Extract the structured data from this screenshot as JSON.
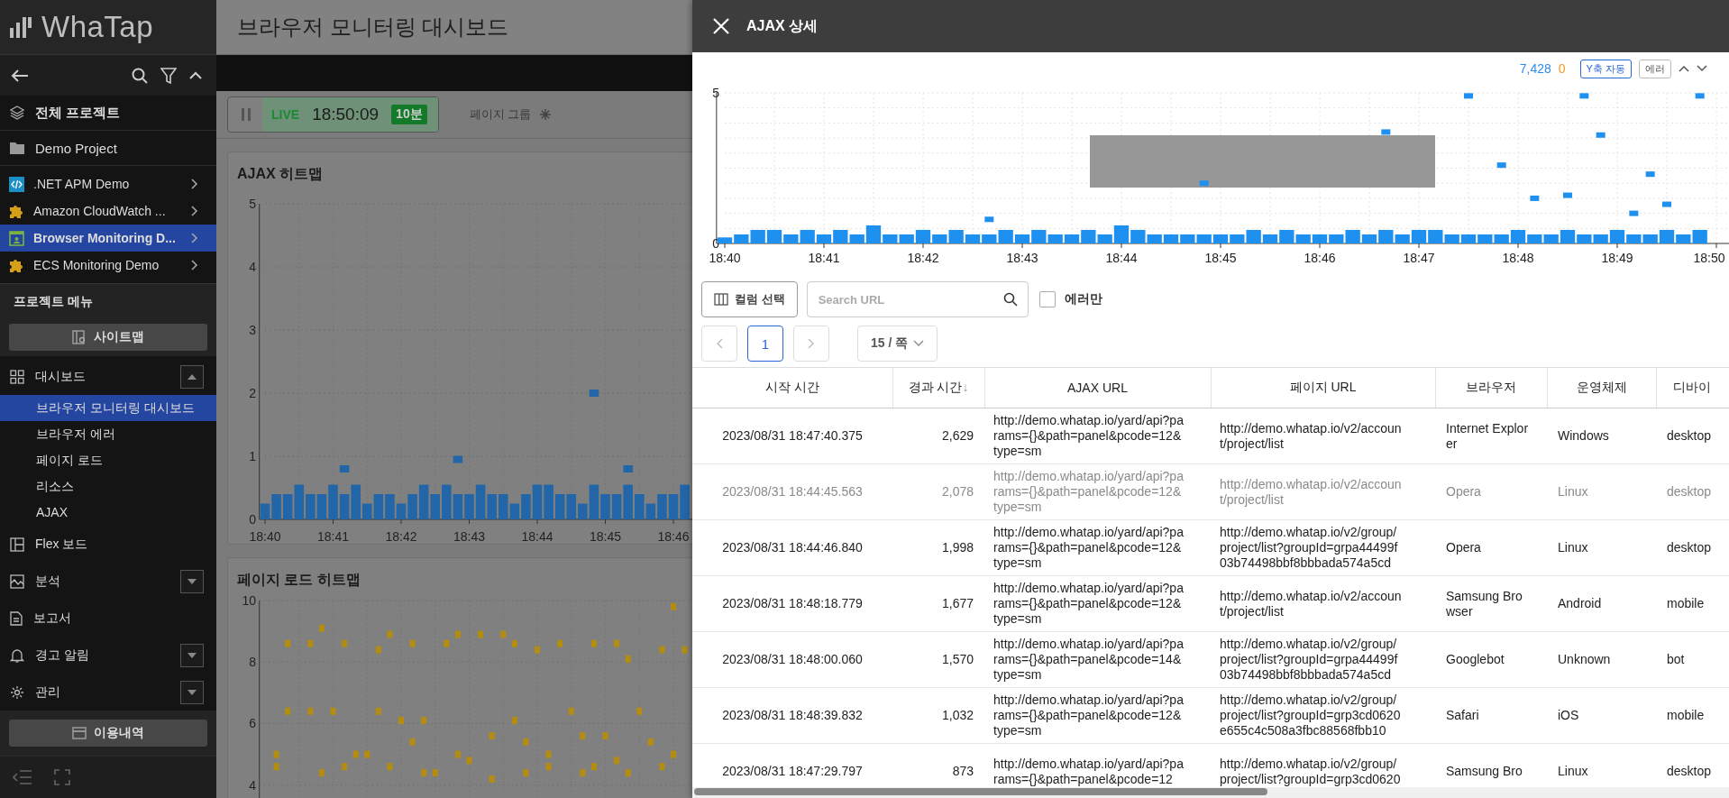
{
  "sidebar": {
    "logo": "WhaTap",
    "all_projects": "전체 프로젝트",
    "group": "Demo Project",
    "projects": [
      {
        "label": ".NET APM Demo",
        "selected": false
      },
      {
        "label": "Amazon CloudWatch ...",
        "selected": false
      },
      {
        "label": "Browser Monitoring D...",
        "selected": true
      },
      {
        "label": "ECS Monitoring Demo",
        "selected": false
      }
    ],
    "menu_title": "프로젝트 메뉴",
    "sitemap_button": "사이트맵",
    "menu": [
      {
        "kind": "group",
        "label": "대시보드",
        "expanded": true,
        "children": [
          {
            "label": "브라우저 모니터링 대시보드",
            "selected": true
          },
          {
            "label": "브라우저 에러",
            "selected": false
          },
          {
            "label": "페이지 로드",
            "selected": false
          },
          {
            "label": "리소스",
            "selected": false
          },
          {
            "label": "AJAX",
            "selected": false
          }
        ]
      },
      {
        "kind": "link",
        "label": "Flex 보드"
      },
      {
        "kind": "group",
        "label": "분석",
        "expanded": false
      },
      {
        "kind": "link",
        "label": "보고서"
      },
      {
        "kind": "group",
        "label": "경고 알림",
        "expanded": false
      },
      {
        "kind": "group",
        "label": "관리",
        "expanded": false
      }
    ],
    "usage_button": "이용내역"
  },
  "dashboard": {
    "title": "브라우저 모니터링 대시보드",
    "live": {
      "label": "LIVE",
      "time": "18:50:09",
      "range": "10분"
    },
    "page_group": "페이지 그룹",
    "ajax_heatmap": {
      "title": "AJAX 히트맵",
      "chart_data": {
        "type": "bar",
        "grid": true,
        "categories": [
          "18:40",
          null,
          null,
          null,
          null,
          null,
          "18:41",
          null,
          null,
          null,
          null,
          null,
          "18:42",
          null,
          null,
          null,
          null,
          null,
          "18:43",
          null,
          null,
          null,
          null,
          null,
          "18:44",
          null,
          null,
          null,
          null,
          null,
          "18:45",
          null,
          null,
          null,
          null,
          null,
          "18:46",
          null
        ],
        "series": [
          {
            "color": "#2266a8",
            "values": [
              0.25,
              0.4,
              0.4,
              0.55,
              0.4,
              0.4,
              0.55,
              0.4,
              0.55,
              0.25,
              0.4,
              0.4,
              0.25,
              0.4,
              0.55,
              0.4,
              0.55,
              0.4,
              0.4,
              0.55,
              0.4,
              0.4,
              0.25,
              0.4,
              0.55,
              0.55,
              0.4,
              0.4,
              0.25,
              0.55,
              0.4,
              0.4,
              0.55,
              0.4,
              0.25,
              0.4,
              0.4,
              0.55
            ]
          },
          {
            "type": "scatter",
            "color": "#2266a8",
            "values": [
              null,
              null,
              null,
              null,
              null,
              null,
              null,
              0.8,
              null,
              null,
              null,
              null,
              null,
              null,
              null,
              null,
              null,
              0.95,
              null,
              null,
              null,
              null,
              null,
              null,
              null,
              null,
              null,
              null,
              null,
              2.0,
              null,
              null,
              0.8,
              null,
              null,
              null,
              null,
              null
            ]
          }
        ],
        "ylim": [
          0,
          5
        ],
        "yticks": [
          0,
          1,
          2,
          3,
          4,
          5
        ]
      }
    },
    "pageload_heatmap": {
      "title": "페이지 로드 히트맵",
      "chart_data": {
        "type": "scatter",
        "grid": true,
        "categories": [
          null,
          null,
          null,
          null,
          null,
          null,
          null,
          null,
          null,
          null,
          null,
          null,
          null,
          null,
          null,
          null,
          null,
          null,
          null,
          null,
          null,
          null,
          null,
          null,
          null,
          null,
          null,
          null,
          null,
          null,
          null,
          null,
          null,
          null,
          null,
          null,
          null,
          null
        ],
        "series": [
          {
            "color": "#b38c10",
            "values": [
              null,
              null,
              8.6,
              null,
              8.6,
              9.1,
              null,
              8.6,
              null,
              null,
              8.4,
              8.9,
              null,
              8.6,
              null,
              null,
              8.6,
              8.9,
              null,
              8.9,
              null,
              8.9,
              8.6,
              null,
              8.4,
              null,
              8.6,
              null,
              null,
              8.6,
              null,
              8.6,
              8.1,
              null,
              null,
              8.4,
              9.8,
              8.4
            ]
          },
          {
            "color": "#b38c10",
            "values": [
              null,
              5.0,
              6.4,
              null,
              6.4,
              null,
              6.4,
              null,
              null,
              null,
              6.4,
              null,
              6.1,
              5.4,
              6.1,
              null,
              null,
              null,
              null,
              null,
              5.6,
              null,
              6.1,
              5.4,
              null,
              5.0,
              null,
              6.4,
              5.6,
              null,
              5.6,
              null,
              null,
              6.4,
              5.4,
              null,
              null,
              null
            ]
          },
          {
            "color": "#b38c10",
            "values": [
              null,
              4.6,
              null,
              null,
              null,
              4.4,
              null,
              4.6,
              5.0,
              5.0,
              null,
              4.6,
              null,
              null,
              4.4,
              4.4,
              null,
              5.0,
              4.8,
              null,
              4.2,
              null,
              null,
              4.4,
              null,
              4.6,
              null,
              null,
              4.4,
              4.6,
              null,
              4.8,
              4.4,
              null,
              null,
              4.6,
              5.0,
              null
            ]
          }
        ],
        "ylim": [
          3.2,
          10
        ],
        "yticks": [
          4,
          6,
          8,
          10
        ]
      }
    }
  },
  "drawer": {
    "title": "AJAX 상세",
    "total": "7,428",
    "errors": "0",
    "toggles": [
      {
        "label": "Y축 자동",
        "selected": true
      },
      {
        "label": "에러",
        "selected": false
      }
    ],
    "chart_selection": true,
    "chart_data": {
      "type": "bar",
      "grid": true,
      "categories": [
        "18:40",
        null,
        null,
        null,
        null,
        null,
        "18:41",
        null,
        null,
        null,
        null,
        null,
        "18:42",
        null,
        null,
        null,
        null,
        null,
        "18:43",
        null,
        null,
        null,
        null,
        null,
        "18:44",
        null,
        null,
        null,
        null,
        null,
        "18:45",
        null,
        null,
        null,
        null,
        null,
        "18:46",
        null,
        null,
        null,
        null,
        null,
        "18:47",
        null,
        null,
        null,
        null,
        null,
        "18:48",
        null,
        null,
        null,
        null,
        null,
        "18:49",
        null,
        null,
        null,
        null,
        null,
        "18:50"
      ],
      "series": [
        {
          "color": "#1e90f0",
          "values": [
            0.2,
            0.3,
            0.45,
            0.45,
            0.3,
            0.45,
            0.3,
            0.45,
            0.3,
            0.6,
            0.3,
            0.3,
            0.45,
            0.3,
            0.45,
            0.3,
            0.3,
            0.45,
            0.3,
            0.45,
            0.3,
            0.3,
            0.45,
            0.3,
            0.6,
            0.45,
            0.3,
            0.3,
            0.3,
            0.3,
            0.3,
            0.3,
            0.45,
            0.3,
            0.45,
            0.3,
            0.3,
            0.3,
            0.45,
            0.3,
            0.45,
            0.3,
            0.45,
            0.45,
            0.3,
            0.3,
            0.3,
            0.3,
            0.45,
            0.3,
            0.3,
            0.45,
            0.3,
            0.3,
            0.45,
            0.3,
            0.3,
            0.45,
            0.3,
            0.45,
            null
          ]
        },
        {
          "type": "scatter",
          "color": "#1e90f0",
          "values": [
            null,
            null,
            null,
            null,
            null,
            null,
            null,
            null,
            null,
            null,
            null,
            null,
            null,
            null,
            null,
            null,
            0.8,
            null,
            null,
            null,
            null,
            null,
            null,
            null,
            null,
            null,
            null,
            null,
            null,
            2.0,
            null,
            null,
            null,
            null,
            null,
            null,
            null,
            null,
            null,
            null,
            3.7,
            null,
            null,
            null,
            null,
            4.9,
            null,
            2.6,
            null,
            1.5,
            null,
            1.6,
            4.9,
            3.6,
            null,
            1.0,
            2.3,
            1.3,
            null,
            4.9,
            null
          ]
        }
      ],
      "ylim": [
        0,
        5
      ],
      "yticks": [
        0,
        5
      ]
    },
    "column_button": "컬럼 선택",
    "search": {
      "placeholder": "Search URL"
    },
    "errors_only": {
      "label": "에러만",
      "checked": false
    },
    "pages": [
      {
        "label": "1",
        "selected": true
      }
    ],
    "page_size": "15 / 쪽",
    "columns": [
      {
        "label": "시작 시간"
      },
      {
        "label": "경과 시간",
        "sort_mark": "↓"
      },
      {
        "label": "AJAX URL"
      },
      {
        "label": "페이지 URL"
      },
      {
        "label": "브라우저"
      },
      {
        "label": "운영체제"
      },
      {
        "label": "디바이"
      }
    ],
    "rows": [
      {
        "start": "2023/08/31 18:47:40.375",
        "elapsed": "2,629",
        "ajax_url": "http://demo.whatap.io/yard/api?params={}&path=panel&pcode=12&type=sm",
        "page_url": "http://demo.whatap.io/v2/account/project/list",
        "browser": "Internet Explorer",
        "os": "Windows",
        "device": "desktop",
        "dimmed": false
      },
      {
        "start": "2023/08/31 18:44:45.563",
        "elapsed": "2,078",
        "ajax_url": "http://demo.whatap.io/yard/api?params={}&path=panel&pcode=12&type=sm",
        "page_url": "http://demo.whatap.io/v2/account/project/list",
        "browser": "Opera",
        "os": "Linux",
        "device": "desktop",
        "dimmed": true
      },
      {
        "start": "2023/08/31 18:44:46.840",
        "elapsed": "1,998",
        "ajax_url": "http://demo.whatap.io/yard/api?params={}&path=panel&pcode=12&type=sm",
        "page_url": "http://demo.whatap.io/v2/group/project/list?groupId=grpa44499f03b74498bbf8bbbada574a5cd",
        "browser": "Opera",
        "os": "Linux",
        "device": "desktop",
        "dimmed": false
      },
      {
        "start": "2023/08/31 18:48:18.779",
        "elapsed": "1,677",
        "ajax_url": "http://demo.whatap.io/yard/api?params={}&path=panel&pcode=12&type=sm",
        "page_url": "http://demo.whatap.io/v2/account/project/list",
        "browser": "Samsung Browser",
        "os": "Android",
        "device": "mobile",
        "dimmed": false
      },
      {
        "start": "2023/08/31 18:48:00.060",
        "elapsed": "1,570",
        "ajax_url": "http://demo.whatap.io/yard/api?params={}&path=panel&pcode=14&type=sm",
        "page_url": "http://demo.whatap.io/v2/group/project/list?groupId=grpa44499f03b74498bbf8bbbada574a5cd",
        "browser": "Googlebot",
        "os": "Unknown",
        "device": "bot",
        "dimmed": false
      },
      {
        "start": "2023/08/31 18:48:39.832",
        "elapsed": "1,032",
        "ajax_url": "http://demo.whatap.io/yard/api?params={}&path=panel&pcode=12&type=sm",
        "page_url": "http://demo.whatap.io/v2/group/project/list?groupId=grp3cd0620e655c4c508a3fbc88568fbb10",
        "browser": "Safari",
        "os": "iOS",
        "device": "mobile",
        "dimmed": false
      },
      {
        "start": "2023/08/31 18:47:29.797",
        "elapsed": "873",
        "ajax_url": "http://demo.whatap.io/yard/api?params={}&path=panel&pcode=12",
        "page_url": "http://demo.whatap.io/v2/group/project/list?groupId=grp3cd0620",
        "browser": "Samsung Bro",
        "os": "Linux",
        "device": "desktop",
        "dimmed": false
      }
    ]
  }
}
